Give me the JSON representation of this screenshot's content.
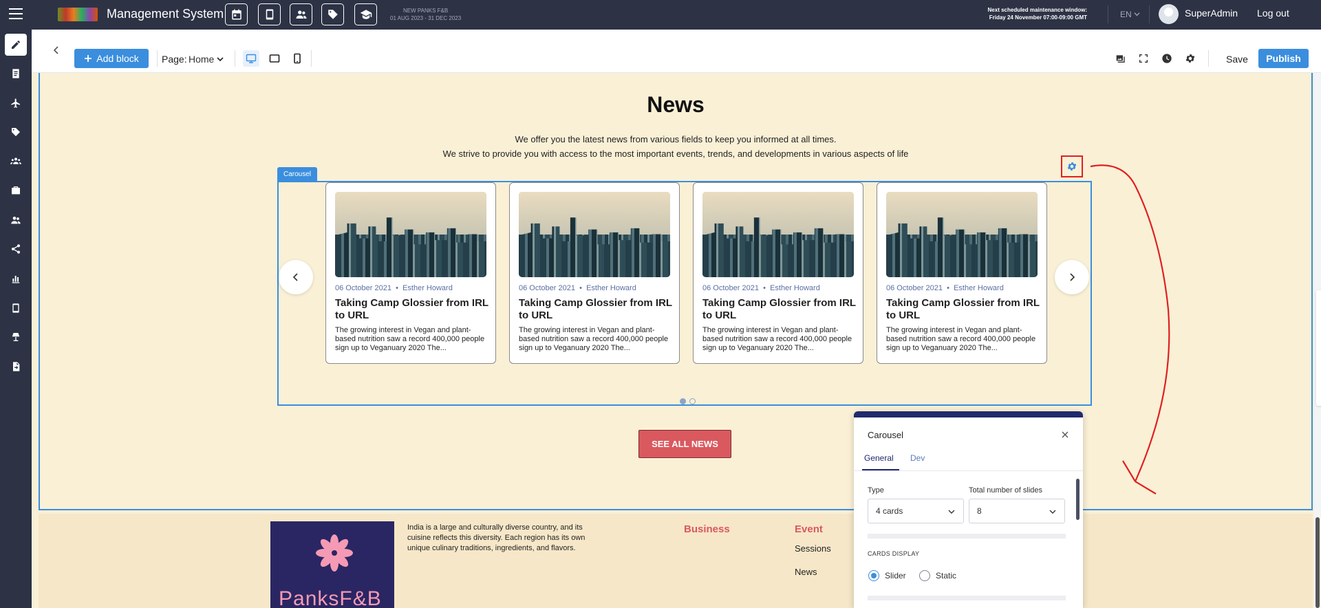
{
  "topbar": {
    "title": "Management System",
    "event_name": "NEW PANKS F&B",
    "event_dates": "01 AUG 2023 - 31 DEC 2023",
    "maintenance_line1": "Next scheduled maintenance window:",
    "maintenance_line2": "Friday 24 November 07:00-09:00 GMT",
    "language": "EN",
    "username": "SuperAdmin",
    "logout": "Log out"
  },
  "editor": {
    "add_block": "Add block",
    "page_label": "Page:",
    "page_value": "Home",
    "save": "Save",
    "publish": "Publish"
  },
  "news": {
    "title": "News",
    "subtitle_line1": "We offer you the latest news from various fields to keep you informed at all times.",
    "subtitle_line2": "We strive to provide you with access to the most important events, trends, and developments in various aspects of life",
    "carousel_tag": "Carousel",
    "see_all": "SEE ALL NEWS",
    "cards": [
      {
        "date": "06 October 2021",
        "author": "Esther Howard",
        "title": "Taking Camp Glossier from IRL to URL",
        "desc": "The growing interest in Vegan and plant-based nutrition saw a record 400,000 people sign up to Veganuary 2020 The..."
      },
      {
        "date": "06 October 2021",
        "author": "Esther Howard",
        "title": "Taking Camp Glossier from IRL to URL",
        "desc": "The growing interest in Vegan and plant-based nutrition saw a record 400,000 people sign up to Veganuary 2020 The..."
      },
      {
        "date": "06 October 2021",
        "author": "Esther Howard",
        "title": "Taking Camp Glossier from IRL to URL",
        "desc": "The growing interest in Vegan and plant-based nutrition saw a record 400,000 people sign up to Veganuary 2020 The..."
      },
      {
        "date": "06 October 2021",
        "author": "Esther Howard",
        "title": "Taking Camp Glossier from IRL to URL",
        "desc": "The growing interest in Vegan and plant-based nutrition saw a record 400,000 people sign up to Veganuary 2020 The..."
      }
    ],
    "meta_separator": "•"
  },
  "footer": {
    "logo_text": "PanksF&B",
    "about": "India is a large and culturally diverse country, and its cuisine reflects this diversity. Each region has its own unique culinary traditions, ingredients, and flavors.",
    "col_business": "Business",
    "col_event": "Event",
    "link_sessions": "Sessions",
    "link_news": "News"
  },
  "panel": {
    "title": "Carousel",
    "tab_general": "General",
    "tab_dev": "Dev",
    "type_label": "Type",
    "type_value": "4 cards",
    "slides_label": "Total number of slides",
    "slides_value": "8",
    "cards_display_label": "CARDS DISPLAY",
    "option_slider": "Slider",
    "option_static": "Static"
  },
  "colors": {
    "topbar": "#2d3345",
    "accent": "#3b8ede",
    "canvas_bg": "#faf0d6",
    "cta": "#d9595f",
    "annotation": "#e02020"
  }
}
